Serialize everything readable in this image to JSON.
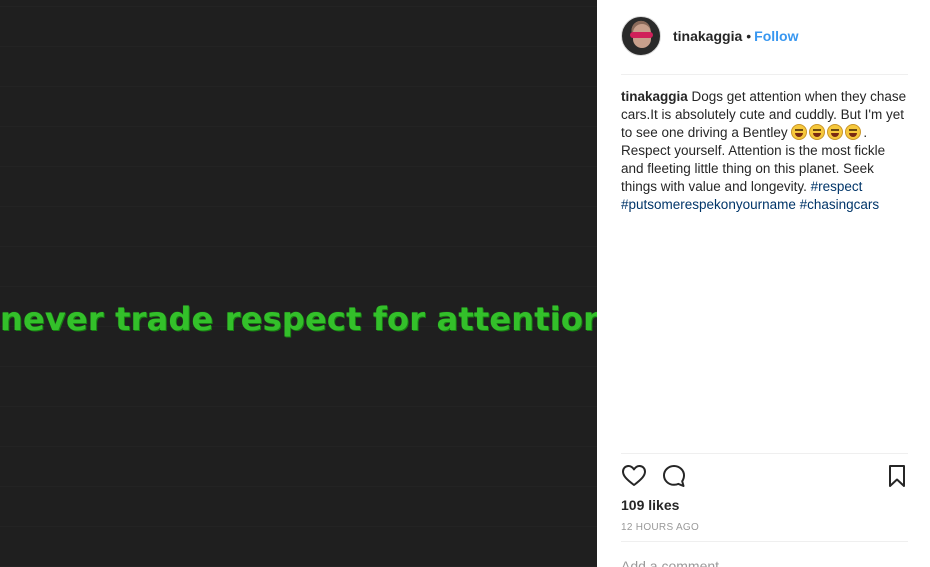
{
  "media": {
    "text": "never trade respect for attention.",
    "text_color": "#33c02a",
    "background_color": "#1f1f1f"
  },
  "header": {
    "username": "tinakaggia",
    "separator": "•",
    "follow_label": "Follow"
  },
  "caption": {
    "username": "tinakaggia",
    "text_1": " Dogs get attention when they chase cars.It is absolutely cute and cuddly. But I'm yet to see one driving a Bentley ",
    "text_2": ". Respect yourself. Attention is the most fickle and fleeting little thing on this planet. Seek things with value and longevity. ",
    "hashtags": [
      "#respect",
      "#putsomerespekonyourname",
      "#chasingcars"
    ],
    "emoji": "laughing-crying-face"
  },
  "actions": {
    "like_icon": "heart-icon",
    "comment_icon": "comment-bubble-icon",
    "save_icon": "bookmark-icon"
  },
  "likes": "109 likes",
  "timestamp": "12 HOURS AGO",
  "comment": {
    "placeholder": "Add a comment..."
  },
  "colors": {
    "link": "#3897f0",
    "hashtag": "#003569",
    "muted": "#999999"
  }
}
